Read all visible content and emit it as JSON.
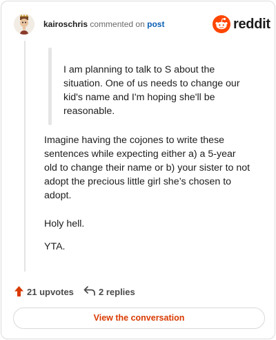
{
  "header": {
    "username": "kairoschris",
    "action": "commented on",
    "post_link": "post",
    "brand": "reddit"
  },
  "colors": {
    "brand_orange": "#ff4500",
    "upvote": "#d93a00",
    "link_blue": "#0a5fb4"
  },
  "comment": {
    "quote": "I am planning to talk to S about the situation. One of us needs to change our kid's name and I'm hoping she'll be reasonable.",
    "paragraphs": [
      "Imagine having the cojones to write these sentences while expecting either a) a 5-year old to change their name or b) your sister to not adopt the precious little girl she’s chosen to adopt.",
      "Holy hell.",
      "YTA."
    ]
  },
  "stats": {
    "upvotes": "21 upvotes",
    "replies": "2 replies",
    "upvote_icon": "upvote-arrow-icon",
    "reply_icon": "reply-arrow-icon"
  },
  "cta": {
    "label": "View the conversation"
  }
}
